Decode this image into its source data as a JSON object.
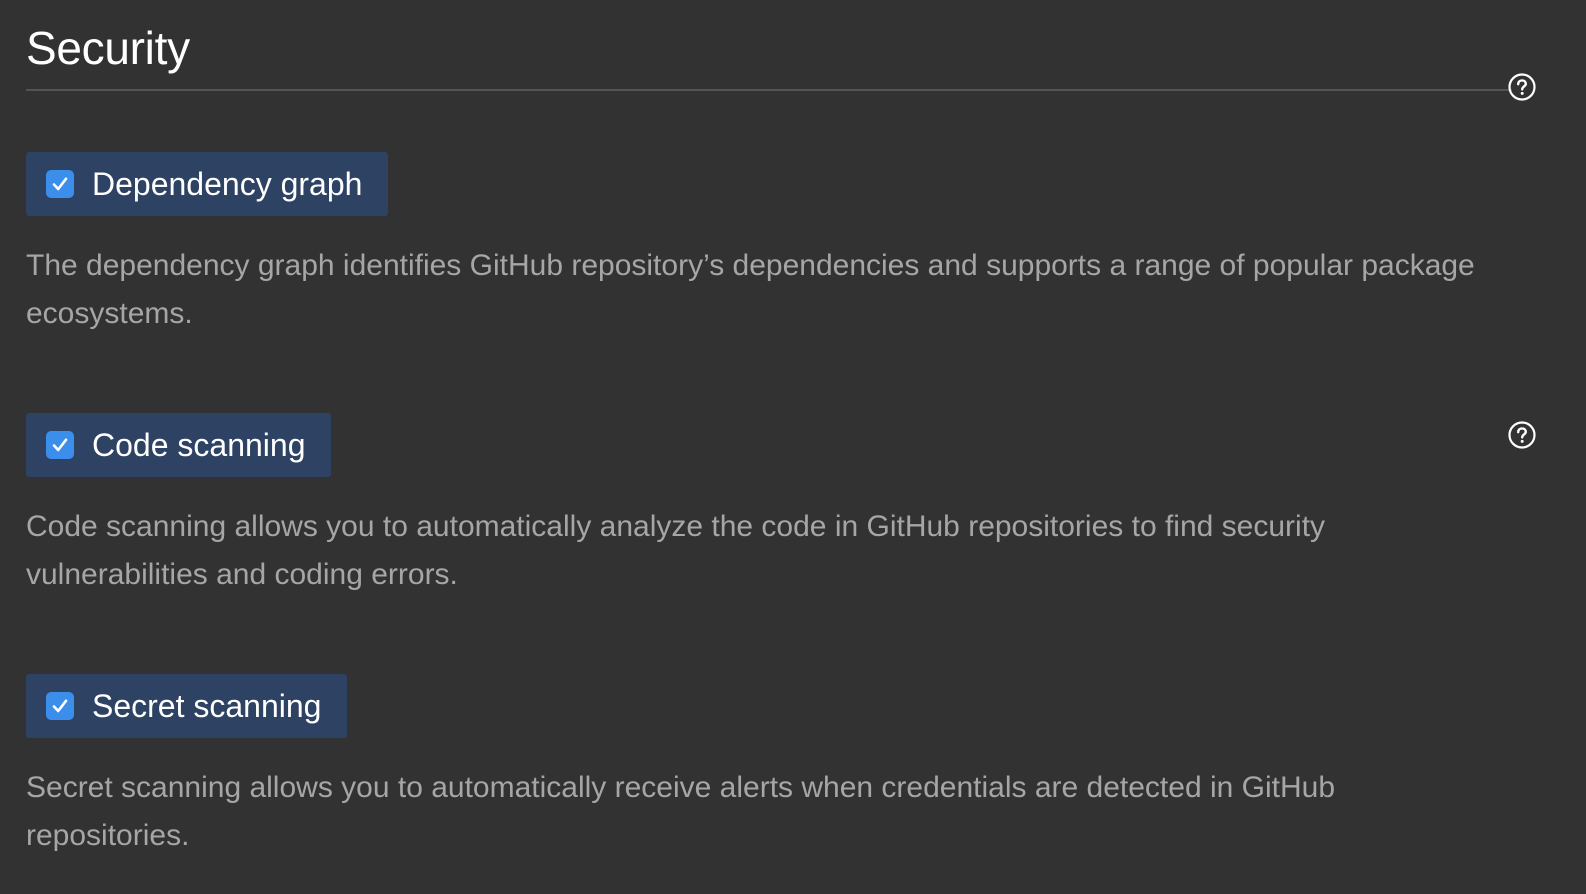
{
  "section": {
    "title": "Security"
  },
  "features": [
    {
      "label": "Dependency graph",
      "checked": true,
      "description": "The dependency graph identifies GitHub repository’s dependencies and supports a range of popular package ecosystems."
    },
    {
      "label": "Code scanning",
      "checked": true,
      "description": "Code scanning allows you to automatically analyze the code in GitHub repositories to find security vulnerabilities and coding errors."
    },
    {
      "label": "Secret scanning",
      "checked": true,
      "description": "Secret scanning allows you to automatically receive alerts when credentials are detected in GitHub repositories."
    }
  ],
  "icons": {
    "help": "question-circle-icon",
    "checkbox": "checkmark-icon"
  },
  "colors": {
    "background": "#323232",
    "toggle_background": "#2e4263",
    "checkbox_accent": "#3b8eea",
    "title_text": "#ffffff",
    "description_text": "#a6a6a6"
  }
}
